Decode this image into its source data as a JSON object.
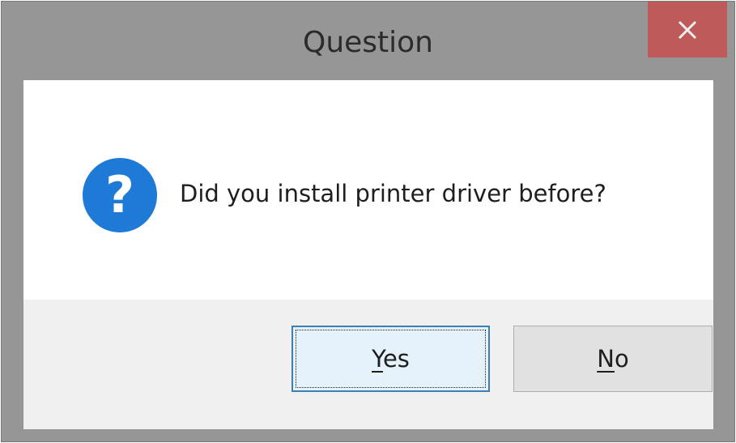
{
  "dialog": {
    "title": "Question",
    "icon": "question-icon",
    "message": "Did you install printer driver before?",
    "close_glyph": "✕",
    "buttons": {
      "yes": {
        "accel": "Y",
        "rest": "es",
        "default": true
      },
      "no": {
        "accel": "N",
        "rest": "o"
      }
    }
  },
  "colors": {
    "frame": "#969696",
    "close_button": "#c75050",
    "icon_blue": "#1e7ad6",
    "default_button_bg": "#e5f1fb",
    "default_button_border": "#3c7fb1"
  }
}
